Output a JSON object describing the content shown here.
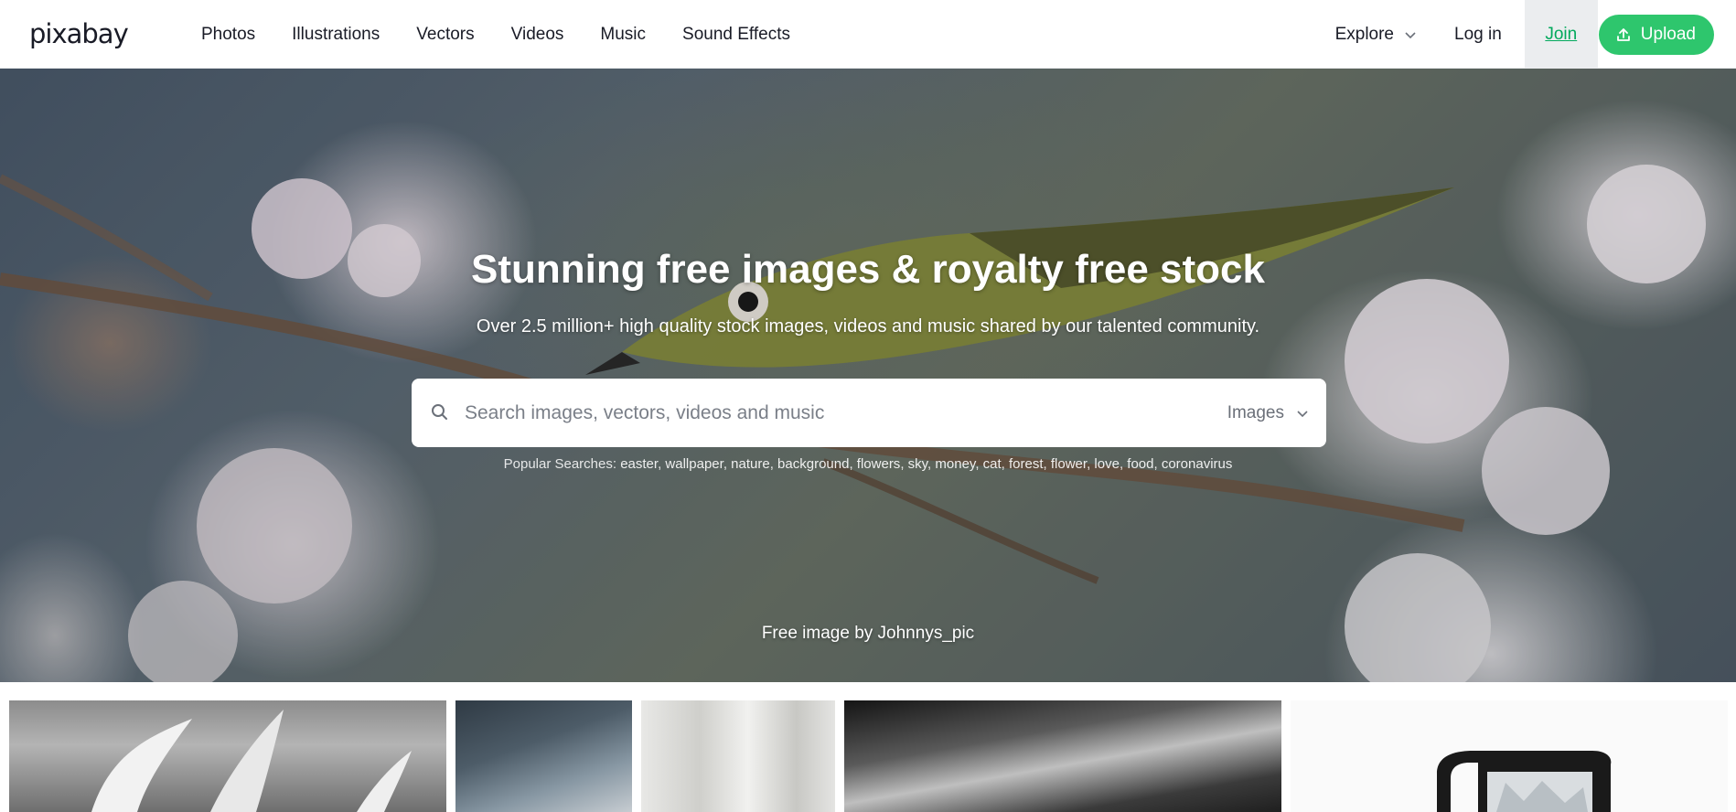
{
  "header": {
    "logo": "pixabay",
    "nav": [
      "Photos",
      "Illustrations",
      "Vectors",
      "Videos",
      "Music",
      "Sound Effects"
    ],
    "explore_label": "Explore",
    "login_label": "Log in",
    "join_label": "Join",
    "upload_label": "Upload"
  },
  "hero": {
    "title": "Stunning free images & royalty free stock",
    "subtitle": "Over 2.5 million+ high quality stock images, videos and music shared by our talented community.",
    "search": {
      "placeholder": "Search images, vectors, videos and music",
      "value": "",
      "type_selected": "Images"
    },
    "popular_label": "Popular Searches:",
    "popular_tags": [
      "easter",
      "wallpaper",
      "nature",
      "background",
      "flowers",
      "sky",
      "money",
      "cat",
      "forest",
      "flower",
      "love",
      "food",
      "coronavirus"
    ],
    "credit": "Free image by Johnnys_pic"
  },
  "colors": {
    "brand_green": "#2ec66d",
    "join_text": "#02a95c"
  }
}
